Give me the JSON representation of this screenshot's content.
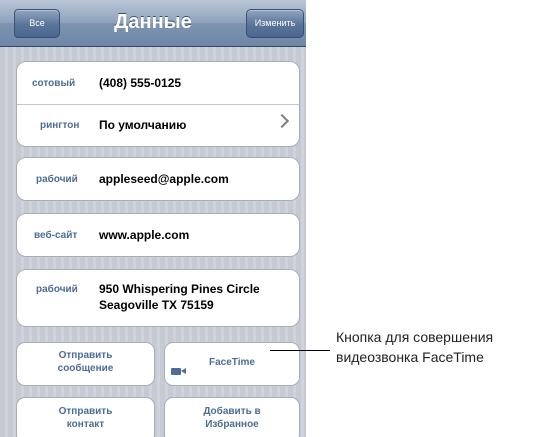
{
  "navbar": {
    "back_label": "Все",
    "title": "Данные",
    "edit_label": "Изменить"
  },
  "phone_card": {
    "label": "сотовый",
    "value": "(408) 555-0125",
    "ringtone_label": "рингтон",
    "ringtone_value": "По умолчанию"
  },
  "email_card": {
    "label": "рабочий",
    "value": "appleseed@apple.com"
  },
  "website_card": {
    "label": "веб-сайт",
    "value": "www.apple.com"
  },
  "address_card": {
    "label": "рабочий",
    "line1": "950 Whispering Pines Circle",
    "line2": "Seagoville TX 75159"
  },
  "actions": {
    "send_message_1": "Отправить",
    "send_message_2": "сообщение",
    "facetime": "FaceTime",
    "share_contact_1": "Отправить",
    "share_contact_2": "контакт",
    "add_favorites_1": "Добавить в",
    "add_favorites_2": "Избранное"
  },
  "callout": {
    "line1": "Кнопка для совершения",
    "line2": "видеозвонка FaceTime"
  },
  "colors": {
    "label_blue": "#4d6d96",
    "nav_blue": "#6f87a7"
  },
  "icons": {
    "chevron": "chevron-right-icon",
    "camera": "video-camera-icon"
  }
}
